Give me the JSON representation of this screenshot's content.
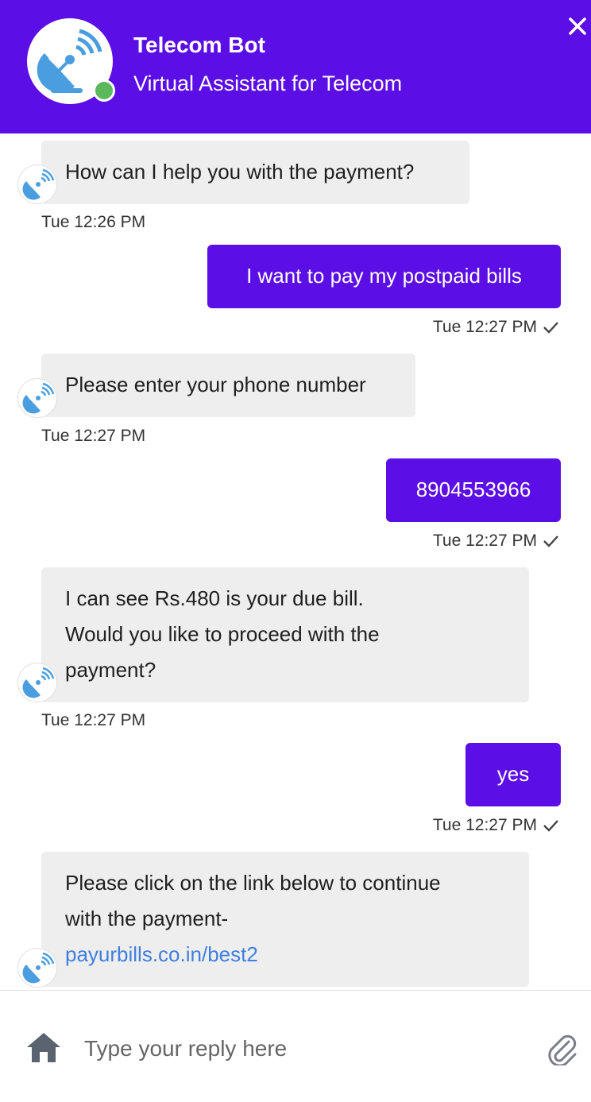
{
  "header": {
    "title": "Telecom Bot",
    "subtitle": "Virtual Assistant for Telecom",
    "status": "online",
    "brand_color": "#5b0fe6",
    "status_color": "#5cb85c",
    "close_icon": "close-icon",
    "avatar_icon": "satellite-dish-icon"
  },
  "messages": [
    {
      "sender": "bot",
      "lines": [
        "How can I help you with the payment?"
      ],
      "time": "Tue 12:26 PM"
    },
    {
      "sender": "user",
      "text": "I want to pay my postpaid bills",
      "time": "Tue 12:27 PM",
      "status": "sent"
    },
    {
      "sender": "bot",
      "lines": [
        "Please enter your phone number"
      ],
      "time": "Tue 12:27 PM"
    },
    {
      "sender": "user",
      "text": "8904553966",
      "time": "Tue 12:27 PM",
      "status": "sent"
    },
    {
      "sender": "bot",
      "lines": [
        "I can see Rs.480 is your due bill.",
        "Would you like to proceed with the",
        "payment?"
      ],
      "time": "Tue 12:27 PM"
    },
    {
      "sender": "user",
      "text": "yes",
      "time": "Tue 12:27 PM",
      "status": "sent"
    },
    {
      "sender": "bot",
      "lines": [
        "Please click on the link below to continue",
        "with the payment-"
      ],
      "link": "payurbills.co.in/best2"
    }
  ],
  "footer": {
    "home_icon": "home-icon",
    "input_placeholder": "Type your reply here",
    "input_value": "",
    "attach_icon": "paperclip-icon"
  }
}
